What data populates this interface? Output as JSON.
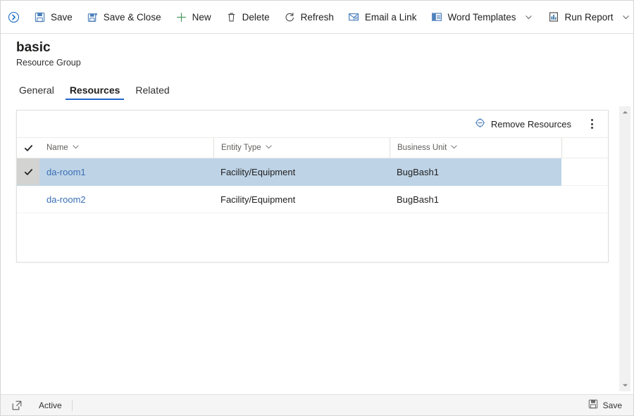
{
  "commandbar": {
    "expand_icon": "expand-collapse-icon",
    "buttons": [
      {
        "label": "Save",
        "icon": "save-icon",
        "caret": false
      },
      {
        "label": "Save & Close",
        "icon": "save-and-close-icon",
        "caret": false
      },
      {
        "label": "New",
        "icon": "plus-icon",
        "caret": false
      },
      {
        "label": "Delete",
        "icon": "trash-icon",
        "caret": false
      },
      {
        "label": "Refresh",
        "icon": "refresh-icon",
        "caret": false
      },
      {
        "label": "Email a Link",
        "icon": "email-link-icon",
        "caret": false
      },
      {
        "label": "Word Templates",
        "icon": "word-template-icon",
        "caret": true
      },
      {
        "label": "Run Report",
        "icon": "report-icon",
        "caret": true
      }
    ]
  },
  "header": {
    "title": "basic",
    "subtitle": "Resource Group"
  },
  "tabs": [
    {
      "label": "General",
      "active": false
    },
    {
      "label": "Resources",
      "active": true
    },
    {
      "label": "Related",
      "active": false
    }
  ],
  "grid": {
    "toolbar": {
      "remove_label": "Remove Resources",
      "remove_icon": "remove-resource-icon",
      "overflow_icon": "more-options-icon"
    },
    "select_all_icon": "checkmark-icon",
    "columns": [
      {
        "label": "Name",
        "sort_icon": "chevron-down-icon"
      },
      {
        "label": "Entity Type",
        "sort_icon": "chevron-down-icon"
      },
      {
        "label": "Business Unit",
        "sort_icon": "chevron-down-icon"
      }
    ],
    "rows": [
      {
        "name": "da-room1",
        "entity_type": "Facility/Equipment",
        "business_unit": "BugBash1",
        "selected": true
      },
      {
        "name": "da-room2",
        "entity_type": "Facility/Equipment",
        "business_unit": "BugBash1",
        "selected": false
      }
    ]
  },
  "scrollbar": {
    "up_icon": "scroll-up-arrow-icon",
    "down_icon": "scroll-down-arrow-icon"
  },
  "statusbar": {
    "popout_icon": "open-in-new-window-icon",
    "status_text": "Active",
    "save_label": "Save",
    "save_icon": "save-icon"
  },
  "colors": {
    "accent": "#2266cc",
    "link": "#3a6fb5",
    "selection": "#bed3e6",
    "selection_gutter": "#d3d3d1",
    "new_icon_green": "#4a9a5e",
    "text_primary": "#201f1e",
    "text_secondary": "#605e5c"
  }
}
